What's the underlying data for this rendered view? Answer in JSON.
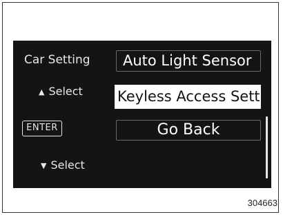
{
  "screen": {
    "title": "Car Setting",
    "up_hint": {
      "icon": "up-triangle-icon",
      "glyph": "▲",
      "label": "Select"
    },
    "enter_badge": "ENTER",
    "down_hint": {
      "icon": "down-triangle-icon",
      "glyph": "▼",
      "label": "Select"
    },
    "menu": [
      {
        "label": "Auto Light Sensor",
        "selected": false
      },
      {
        "label": "Keyless Access Setti",
        "selected": true
      },
      {
        "label": "Go Back",
        "selected": false
      }
    ]
  },
  "figure_id": "304663",
  "colors": {
    "screen_bg": "#141414",
    "text": "#e8e8e8",
    "selected_bg": "#ffffff",
    "item_border": "#6a6a6a"
  }
}
